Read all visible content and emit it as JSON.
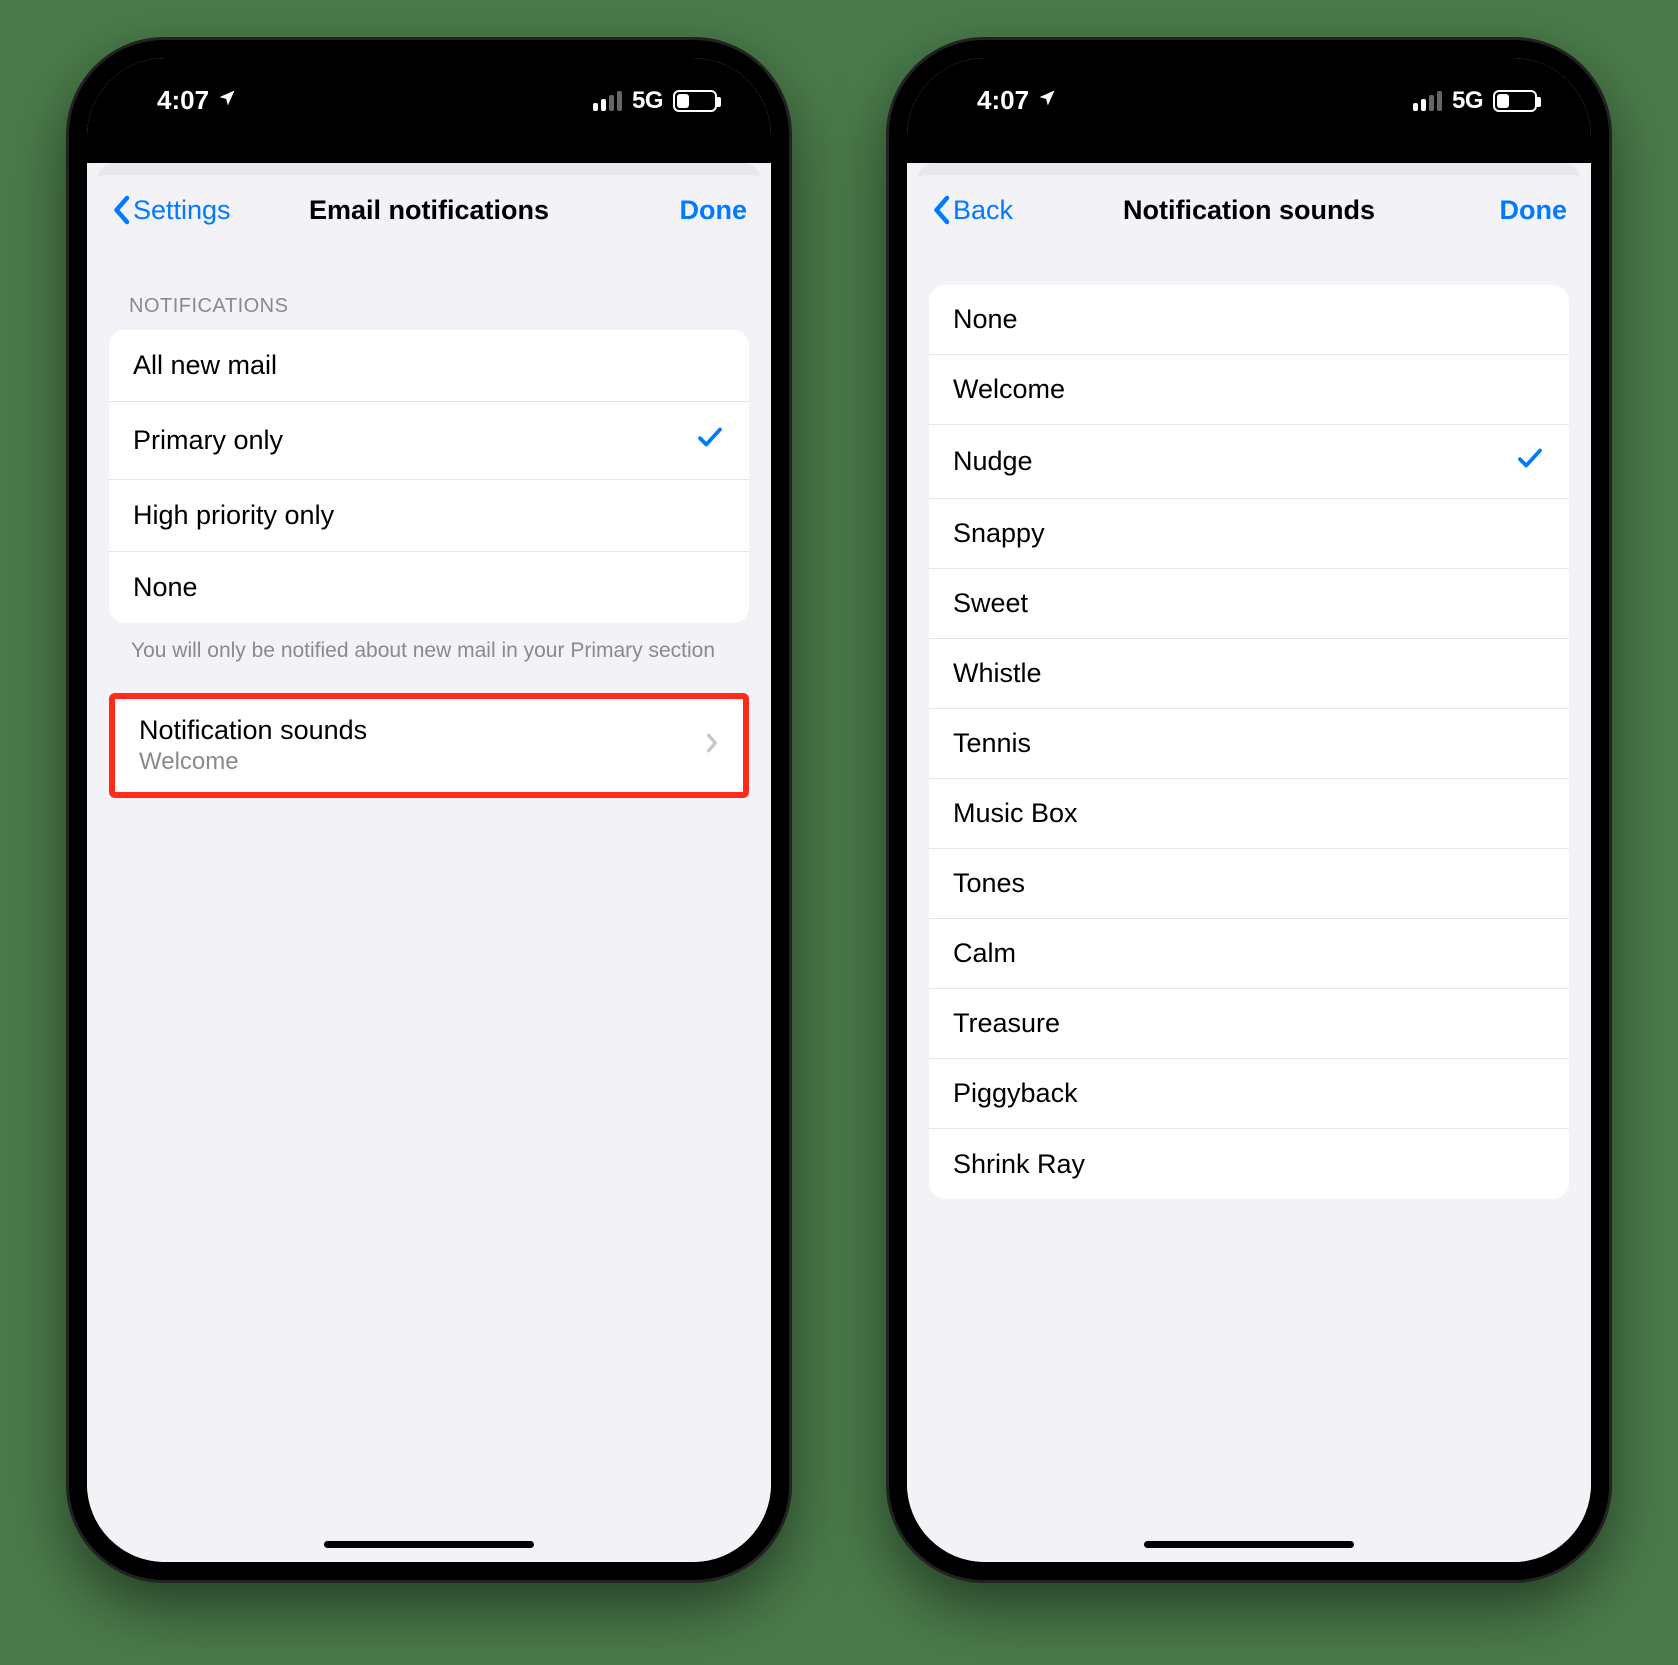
{
  "status": {
    "time": "4:07",
    "network_label": "5G"
  },
  "left": {
    "nav": {
      "back": "Settings",
      "title": "Email notifications",
      "done": "Done"
    },
    "section_header": "NOTIFICATIONS",
    "options": {
      "0": {
        "label": "All new mail",
        "selected": false
      },
      "1": {
        "label": "Primary only",
        "selected": true
      },
      "2": {
        "label": "High priority only",
        "selected": false
      },
      "3": {
        "label": "None",
        "selected": false
      }
    },
    "footer": "You will only be notified about new mail in your Primary section",
    "sounds_row": {
      "title": "Notification sounds",
      "value": "Welcome"
    }
  },
  "right": {
    "nav": {
      "back": "Back",
      "title": "Notification sounds",
      "done": "Done"
    },
    "sounds": {
      "0": {
        "label": "None",
        "selected": false
      },
      "1": {
        "label": "Welcome",
        "selected": false
      },
      "2": {
        "label": "Nudge",
        "selected": true
      },
      "3": {
        "label": "Snappy",
        "selected": false
      },
      "4": {
        "label": "Sweet",
        "selected": false
      },
      "5": {
        "label": "Whistle",
        "selected": false
      },
      "6": {
        "label": "Tennis",
        "selected": false
      },
      "7": {
        "label": "Music Box",
        "selected": false
      },
      "8": {
        "label": "Tones",
        "selected": false
      },
      "9": {
        "label": "Calm",
        "selected": false
      },
      "10": {
        "label": "Treasure",
        "selected": false
      },
      "11": {
        "label": "Piggyback",
        "selected": false
      },
      "12": {
        "label": "Shrink Ray",
        "selected": false
      }
    }
  }
}
